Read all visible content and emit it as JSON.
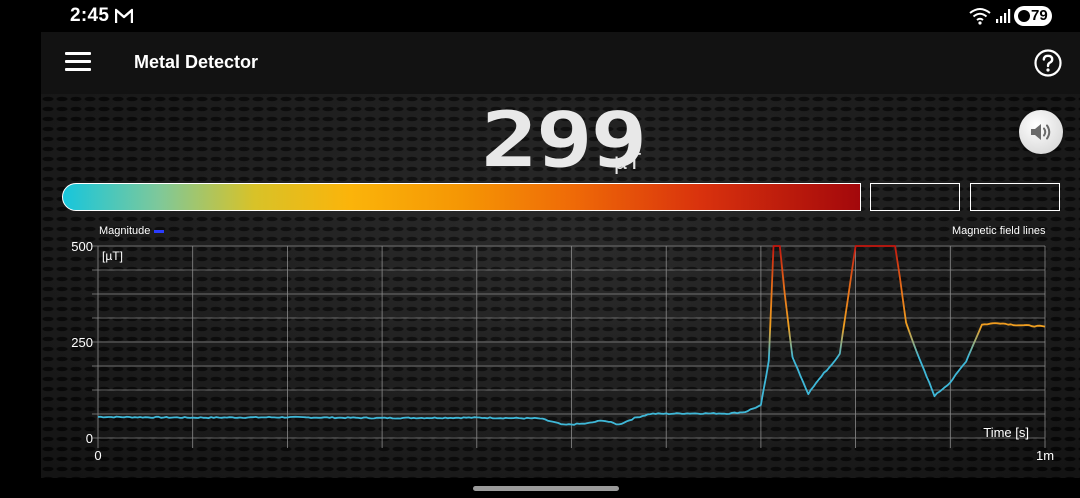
{
  "status_bar": {
    "time": "2:45",
    "battery": "79",
    "icons": [
      "gmail-icon",
      "wifi-icon",
      "signal-icon",
      "battery-icon"
    ]
  },
  "app_bar": {
    "title": "Metal Detector",
    "icons": [
      "menu-icon",
      "help-icon"
    ]
  },
  "reading": {
    "value": "299",
    "unit": "µT",
    "level_fraction": 1.0
  },
  "sound_button": {
    "icon": "speaker-icon"
  },
  "legend": {
    "series_label": "Magnitude",
    "right_label": "Magnetic field lines"
  },
  "colors": {
    "trace_low": "#3fb8d8",
    "trace_mid": "#f0a020",
    "trace_high": "#c4160e",
    "level_start": "#17c6dc",
    "level_end": "#a3080c"
  },
  "chart_data": {
    "type": "line",
    "ylabel": "[µT]",
    "xlabel": "Time [s]",
    "y_ticks": [
      "500",
      "250",
      "0"
    ],
    "x_ticks": [
      "0",
      "1m"
    ],
    "ylim": [
      0,
      500
    ],
    "xlim": [
      0,
      60
    ],
    "grid": true,
    "series": [
      {
        "name": "Magnitude",
        "x": [
          0,
          6,
          12,
          18,
          24,
          28,
          29.5,
          31,
          32,
          33,
          34,
          35,
          36,
          37,
          38,
          39,
          40,
          41,
          42,
          42.5,
          42.8,
          43.2,
          43.5,
          44,
          45,
          46,
          46.5,
          47,
          48,
          49,
          50,
          50.5,
          50.8,
          51.2,
          52,
          53,
          54,
          55,
          56,
          57,
          58,
          60
        ],
        "y": [
          55,
          53,
          54,
          52,
          53,
          51,
          34,
          38,
          46,
          35,
          52,
          63,
          63,
          64,
          64,
          64,
          64,
          68,
          85,
          200,
          500,
          500,
          380,
          210,
          115,
          170,
          190,
          220,
          500,
          500,
          500,
          500,
          420,
          300,
          210,
          110,
          145,
          200,
          295,
          300,
          295,
          290
        ]
      }
    ]
  }
}
